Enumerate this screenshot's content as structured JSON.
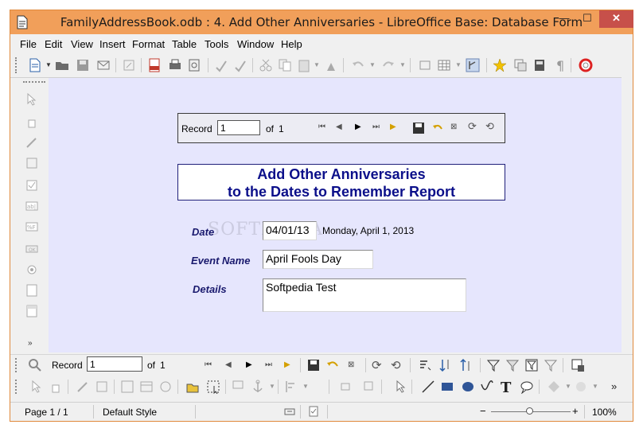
{
  "window": {
    "title": "FamilyAddressBook.odb : 4. Add Other Anniversaries - LibreOffice Base: Database Form",
    "min_label": "—",
    "max_label": "☐",
    "close_label": "✕"
  },
  "menu": [
    "File",
    "Edit",
    "View",
    "Insert",
    "Format",
    "Table",
    "Tools",
    "Window",
    "Help"
  ],
  "form_nav": {
    "record_label": "Record",
    "record_value": "1",
    "of_label": "of",
    "total": "1"
  },
  "form": {
    "title_line1": "Add Other Anniversaries",
    "title_line2": "to the Dates to Remember Report",
    "date_label": "Date",
    "date_value": "04/01/13",
    "date_long": "Monday, April 1, 2013",
    "event_label": "Event Name",
    "event_value": "April Fools Day",
    "details_label": "Details",
    "details_value": "Softpedia Test",
    "watermark": "SOFTPEDIA"
  },
  "bottom_nav": {
    "record_label": "Record",
    "record_value": "1",
    "of_label": "of",
    "total": "1"
  },
  "status": {
    "page": "Page 1 / 1",
    "style": "Default Style",
    "zoom": "100%",
    "zoom_level": 0.5
  },
  "colors": {
    "titlebar": "#f19f5a",
    "canvas": "#e6e6fd",
    "label": "#1a1a6e",
    "title_text": "#0b0f8a"
  }
}
